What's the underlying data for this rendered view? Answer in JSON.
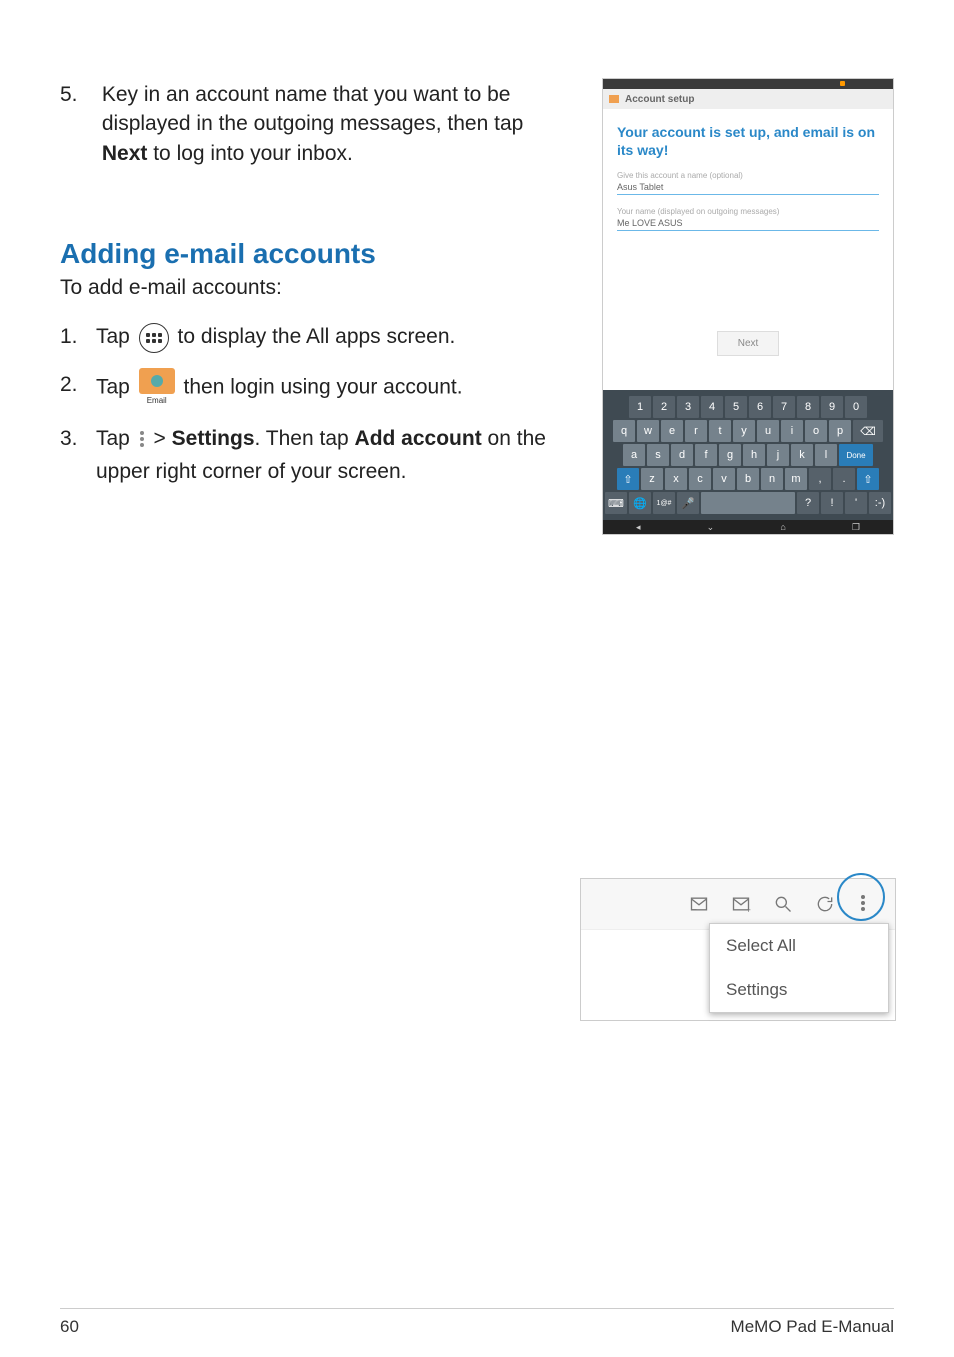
{
  "page": {
    "number": "60",
    "manual": "MeMO Pad E-Manual"
  },
  "step5": {
    "num": "5.",
    "text_a": "Key in an account name that you want to be displayed in the outgoing messages, then tap ",
    "bold": "Next",
    "text_b": " to log into your inbox."
  },
  "section": {
    "heading": "Adding e-mail accounts",
    "sub": "To add e-mail accounts:"
  },
  "steps": {
    "s1": {
      "n": "1.",
      "a": "Tap ",
      "b": " to display the All apps screen."
    },
    "s2": {
      "n": "2.",
      "a": "Tap ",
      "b": " then login using your account.",
      "email_label": "Email"
    },
    "s3": {
      "n": "3.",
      "a": "Tap ",
      "b": " > ",
      "settings": "Settings",
      "c": ". Then tap ",
      "addacct": "Add account",
      "d": " on the upper right corner of your screen."
    }
  },
  "shot1": {
    "title": "Account setup",
    "headline": "Your account is set up, and email is on its way!",
    "label1": "Give this account a name (optional)",
    "val1": "Asus Tablet",
    "label2": "Your name (displayed on outgoing messages)",
    "val2": "Me LOVE ASUS",
    "next": "Next",
    "done": "Done",
    "rows": {
      "r1": [
        "1",
        "2",
        "3",
        "4",
        "5",
        "6",
        "7",
        "8",
        "9",
        "0"
      ],
      "r2": [
        "q",
        "w",
        "e",
        "r",
        "t",
        "y",
        "u",
        "i",
        "o",
        "p"
      ],
      "r3": [
        "a",
        "s",
        "d",
        "f",
        "g",
        "h",
        "j",
        "k",
        "l"
      ],
      "r4": [
        "z",
        "x",
        "c",
        "v",
        "b",
        "n",
        "m",
        ",",
        "."
      ],
      "r5_q": "?",
      "r5_ex": "!",
      "r5_sm": ":-)"
    }
  },
  "shot2": {
    "select_all": "Select All",
    "settings": "Settings"
  }
}
